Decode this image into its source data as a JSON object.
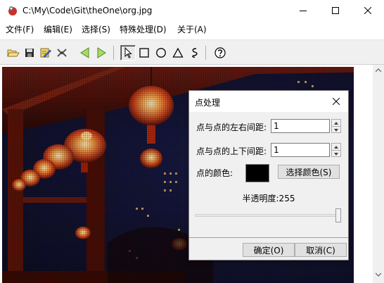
{
  "window": {
    "title": "C:\\My\\Code\\Git\\theOne\\org.jpg"
  },
  "menu": [
    {
      "label": "文件(F)"
    },
    {
      "label": "编辑(E)"
    },
    {
      "label": "选择(S)"
    },
    {
      "label": "特殊处理(D)"
    },
    {
      "label": "关于(A)"
    }
  ],
  "toolbar": {
    "buttons": [
      {
        "icon": "open-folder-icon"
      },
      {
        "icon": "save-icon"
      },
      {
        "icon": "edit-image-icon"
      },
      {
        "icon": "shuffle-icon"
      },
      {
        "icon": "arrow-left-icon"
      },
      {
        "icon": "arrow-right-icon"
      },
      {
        "icon": "select-pointer-icon",
        "pressed": true
      },
      {
        "icon": "rectangle-icon"
      },
      {
        "icon": "ellipse-icon"
      },
      {
        "icon": "triangle-icon"
      },
      {
        "icon": "lasso-icon"
      },
      {
        "icon": "help-icon"
      }
    ]
  },
  "dialog": {
    "title": "点处理",
    "h_spacing_label": "点与点的左右间距:",
    "h_spacing_value": "1",
    "v_spacing_label": "点与点的上下间距:",
    "v_spacing_value": "1",
    "color_label": "点的颜色:",
    "color_value": "#000000",
    "choose_color_button": "选择颜色(S)",
    "opacity_label": "半透明度:255",
    "opacity_value": 255,
    "opacity_max": 255,
    "ok_button": "确定(O)",
    "cancel_button": "取消(C)"
  }
}
